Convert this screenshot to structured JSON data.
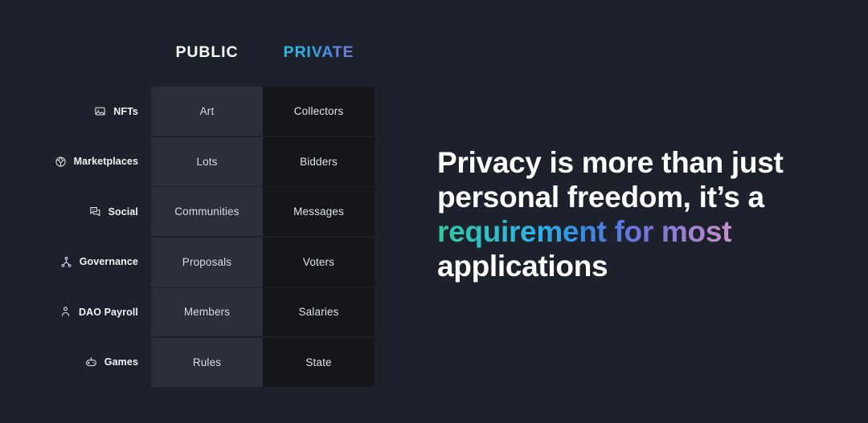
{
  "background_color": "#1d212b",
  "matrix": {
    "columns": [
      {
        "label": "PUBLIC",
        "key": "public",
        "color": "#ffffff"
      },
      {
        "label": "PRIVATE",
        "key": "private",
        "gradient_from": "#2fc6d4",
        "gradient_to": "#a98fd8"
      }
    ],
    "rows": [
      {
        "icon": "image-icon",
        "label": "NFTs",
        "public": "Art",
        "private": "Collectors"
      },
      {
        "icon": "gem-icon",
        "label": "Marketplaces",
        "public": "Lots",
        "private": "Bidders"
      },
      {
        "icon": "chat-bubbles-icon",
        "label": "Social",
        "public": "Communities",
        "private": "Messages"
      },
      {
        "icon": "hierarchy-icon",
        "label": "Governance",
        "public": "Proposals",
        "private": "Voters"
      },
      {
        "icon": "person-icon",
        "label": "DAO Payroll",
        "public": "Members",
        "private": "Salaries"
      },
      {
        "icon": "gamepad-icon",
        "label": "Games",
        "public": "Rules",
        "private": "State"
      }
    ],
    "cell_colors": {
      "public": "#2a2f3a",
      "private": "#141619"
    }
  },
  "headline": {
    "line1": "Privacy is more than just",
    "line2": "personal freedom, it’s a",
    "line3_accent": "requirement for most",
    "line4": "applications",
    "accent_gradient_from": "#33c6a4",
    "accent_gradient_to": "#c490c8"
  }
}
